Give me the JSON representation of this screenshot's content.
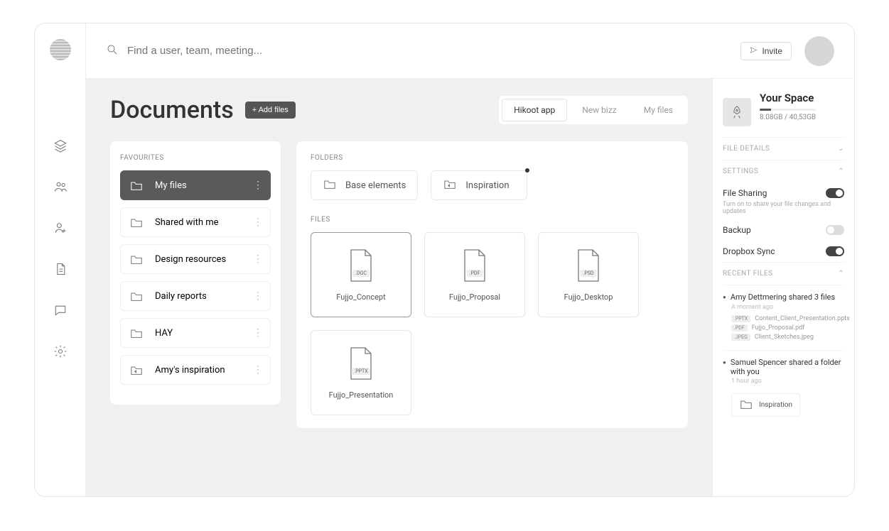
{
  "search": {
    "placeholder": "Find a user, team, meeting..."
  },
  "header": {
    "invite_label": "Invite"
  },
  "page": {
    "title": "Documents",
    "add_files_label": "+ Add files"
  },
  "tabs": [
    {
      "label": "Hikoot app",
      "active": true
    },
    {
      "label": "New bizz",
      "active": false
    },
    {
      "label": "My files",
      "active": false
    }
  ],
  "favourites": {
    "heading": "FAVOURITES",
    "items": [
      {
        "label": "My files",
        "active": true,
        "icon": "folder"
      },
      {
        "label": "Shared with me",
        "active": false,
        "icon": "folder"
      },
      {
        "label": "Design resources",
        "active": false,
        "icon": "folder"
      },
      {
        "label": "Daily reports",
        "active": false,
        "icon": "folder"
      },
      {
        "label": "HAY",
        "active": false,
        "icon": "folder"
      },
      {
        "label": "Amy's inspiration",
        "active": false,
        "icon": "share"
      }
    ]
  },
  "folders": {
    "heading": "FOLDERS",
    "items": [
      {
        "label": "Base elements",
        "icon": "folder",
        "dot": false
      },
      {
        "label": "Inspiration",
        "icon": "share",
        "dot": true
      }
    ]
  },
  "files": {
    "heading": "FILES",
    "items": [
      {
        "name": "Fujjo_Concept",
        "ext": ".DOC",
        "selected": true
      },
      {
        "name": "Fujjo_Proposal",
        "ext": ".PDF",
        "selected": false
      },
      {
        "name": "Fujjo_Desktop",
        "ext": ".PSD",
        "selected": false
      },
      {
        "name": "Fujjo_Presentation",
        "ext": ".PPTX",
        "selected": false
      }
    ]
  },
  "right": {
    "space_title": "Your Space",
    "space_usage": "8.08GB / 40,53GB",
    "sections": {
      "file_details": "FILE DETAILS",
      "settings": "SETTINGS",
      "recent_files": "RECENT FILES"
    },
    "settings": [
      {
        "label": "File Sharing",
        "desc": "Turn on to share your file changes and updates",
        "on": true
      },
      {
        "label": "Backup",
        "desc": "",
        "on": false
      },
      {
        "label": "Dropbox Sync",
        "desc": "",
        "on": true
      }
    ],
    "feed": [
      {
        "title": "Amy Dettmering shared 3 files",
        "time": "A moment ago",
        "files": [
          {
            "tag": ".PPTX",
            "name": "Content_Client_Presentation.pptx"
          },
          {
            "tag": ".PDF",
            "name": "Fujjo_Proposal.pdf"
          },
          {
            "tag": ".JPEG",
            "name": "Client_Sketches.jpeg"
          }
        ]
      },
      {
        "title": "Samuel Spencer shared a folder with you",
        "time": "1 hour ago",
        "folder": "Inspiration"
      }
    ]
  }
}
